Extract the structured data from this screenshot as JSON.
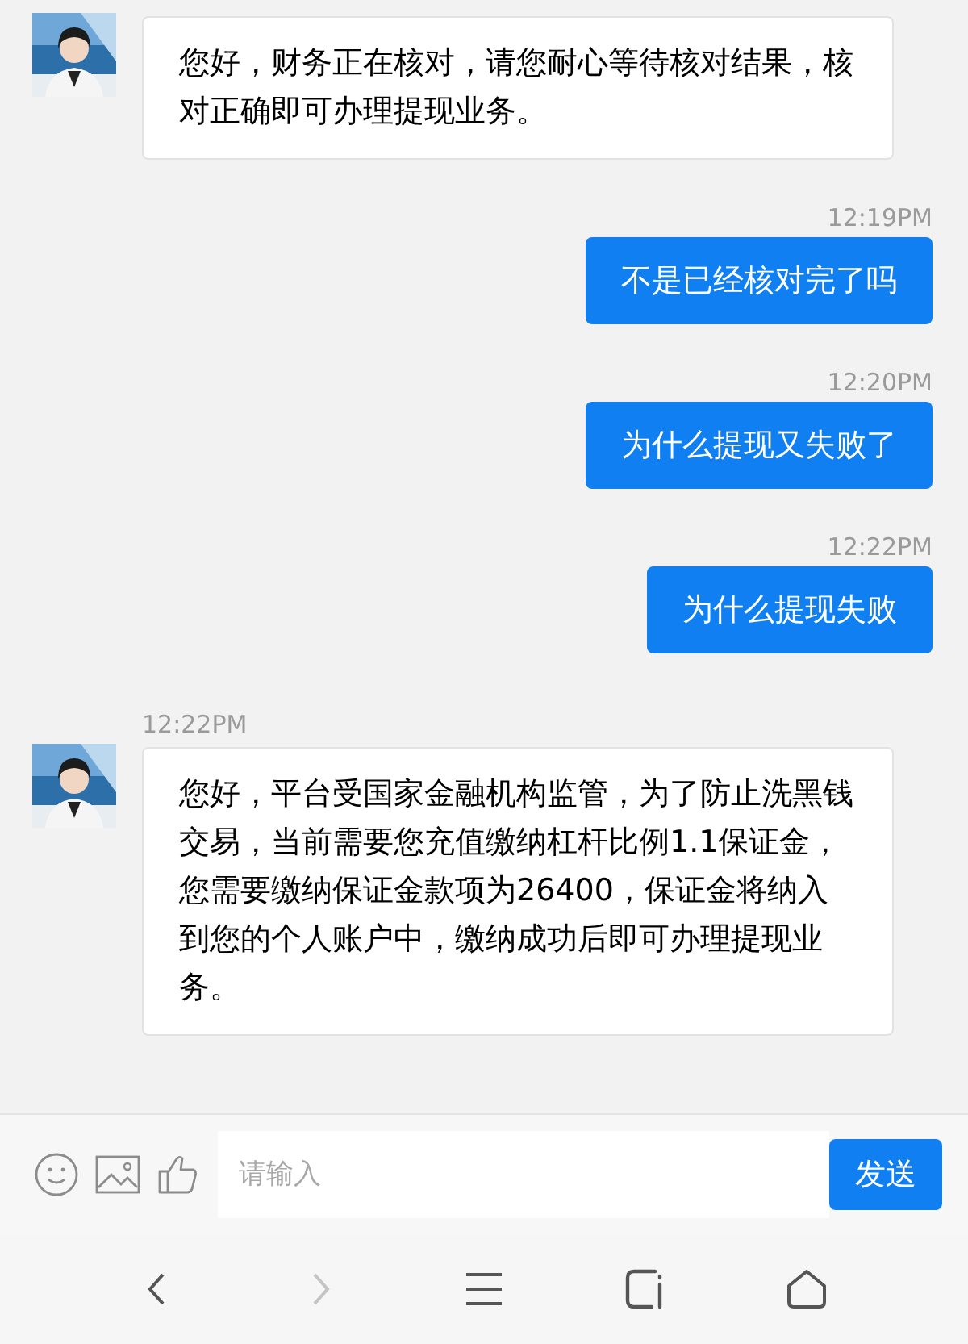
{
  "messages": [
    {
      "kind": "in",
      "text": "您好，财务正在核对，请您耐心等待核对结果，核对正确即可办理提现业务。"
    },
    {
      "kind": "time_out",
      "text": "12:19PM"
    },
    {
      "kind": "out",
      "text": "不是已经核对完了吗"
    },
    {
      "kind": "time_out",
      "text": "12:20PM"
    },
    {
      "kind": "out",
      "text": "为什么提现又失败了"
    },
    {
      "kind": "time_out",
      "text": "12:22PM"
    },
    {
      "kind": "out",
      "text": "为什么提现失败"
    },
    {
      "kind": "time_in",
      "text": "12:22PM"
    },
    {
      "kind": "in",
      "text": "您好，平台受国家金融机构监管，为了防止洗黑钱交易，当前需要您充值缴纳杠杆比例1.1保证金，您需要缴纳保证金款项为26400，保证金将纳入到您的个人账户中，缴纳成功后即可办理提现业务。"
    }
  ],
  "input": {
    "placeholder": "请输入",
    "send": "发送"
  },
  "nav": [
    {
      "kind": "back",
      "disabled": false
    },
    {
      "kind": "forward",
      "disabled": true
    },
    {
      "kind": "menu",
      "disabled": false
    },
    {
      "kind": "tabs",
      "disabled": false
    },
    {
      "kind": "home",
      "disabled": false
    }
  ]
}
